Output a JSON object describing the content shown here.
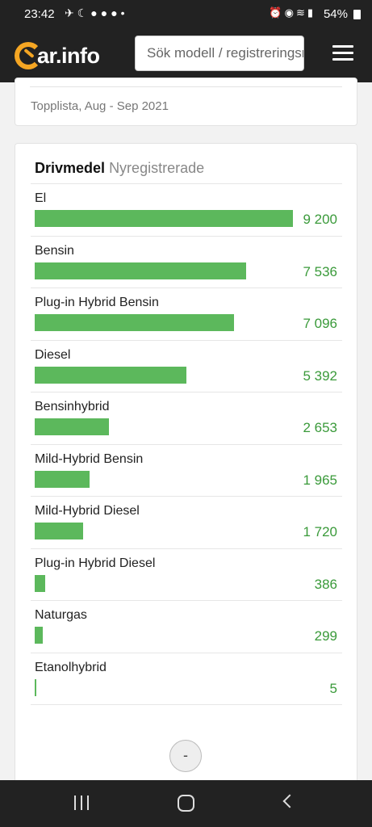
{
  "status": {
    "time": "23:42",
    "battery": "54%"
  },
  "header": {
    "logo_text": "ar.info",
    "search_placeholder": "Sök modell / registreringsnummer"
  },
  "top_card": {
    "subtitle": "Topplista, Aug - Sep 2021"
  },
  "fuel_card": {
    "title": "Drivmedel",
    "subtitle": "Nyregistrerade",
    "rows": [
      {
        "label": "El",
        "value": "9 200",
        "n": 9200
      },
      {
        "label": "Bensin",
        "value": "7 536",
        "n": 7536
      },
      {
        "label": "Plug-in Hybrid Bensin",
        "value": "7 096",
        "n": 7096
      },
      {
        "label": "Diesel",
        "value": "5 392",
        "n": 5392
      },
      {
        "label": "Bensinhybrid",
        "value": "2 653",
        "n": 2653
      },
      {
        "label": "Mild-Hybrid Bensin",
        "value": "1 965",
        "n": 1965
      },
      {
        "label": "Mild-Hybrid Diesel",
        "value": "1 720",
        "n": 1720
      },
      {
        "label": "Plug-in Hybrid Diesel",
        "value": "386",
        "n": 386
      },
      {
        "label": "Naturgas",
        "value": "299",
        "n": 299
      },
      {
        "label": "Etanolhybrid",
        "value": "5",
        "n": 5
      }
    ],
    "collapse_label": "-"
  },
  "colors": {
    "bar": "#5cb85c",
    "value_text": "#3a9a3a",
    "brand": "#f5a623"
  }
}
